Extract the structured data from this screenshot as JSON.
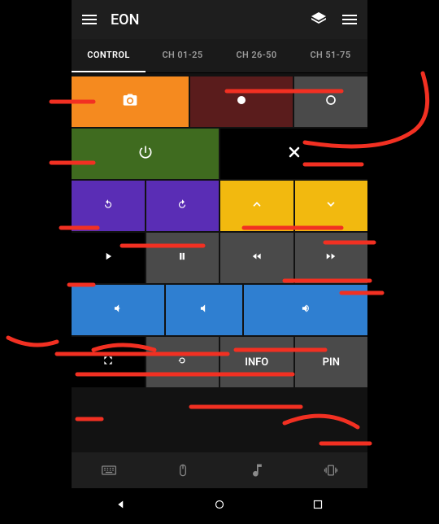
{
  "appbar": {
    "title": "EON"
  },
  "tabs": [
    {
      "label": "CONTROL",
      "active": true
    },
    {
      "label": "CH 01-25",
      "active": false
    },
    {
      "label": "CH 26-50",
      "active": false
    },
    {
      "label": "CH 51-75",
      "active": false
    }
  ],
  "buttons": {
    "info": "INFO",
    "pin": "PIN"
  }
}
